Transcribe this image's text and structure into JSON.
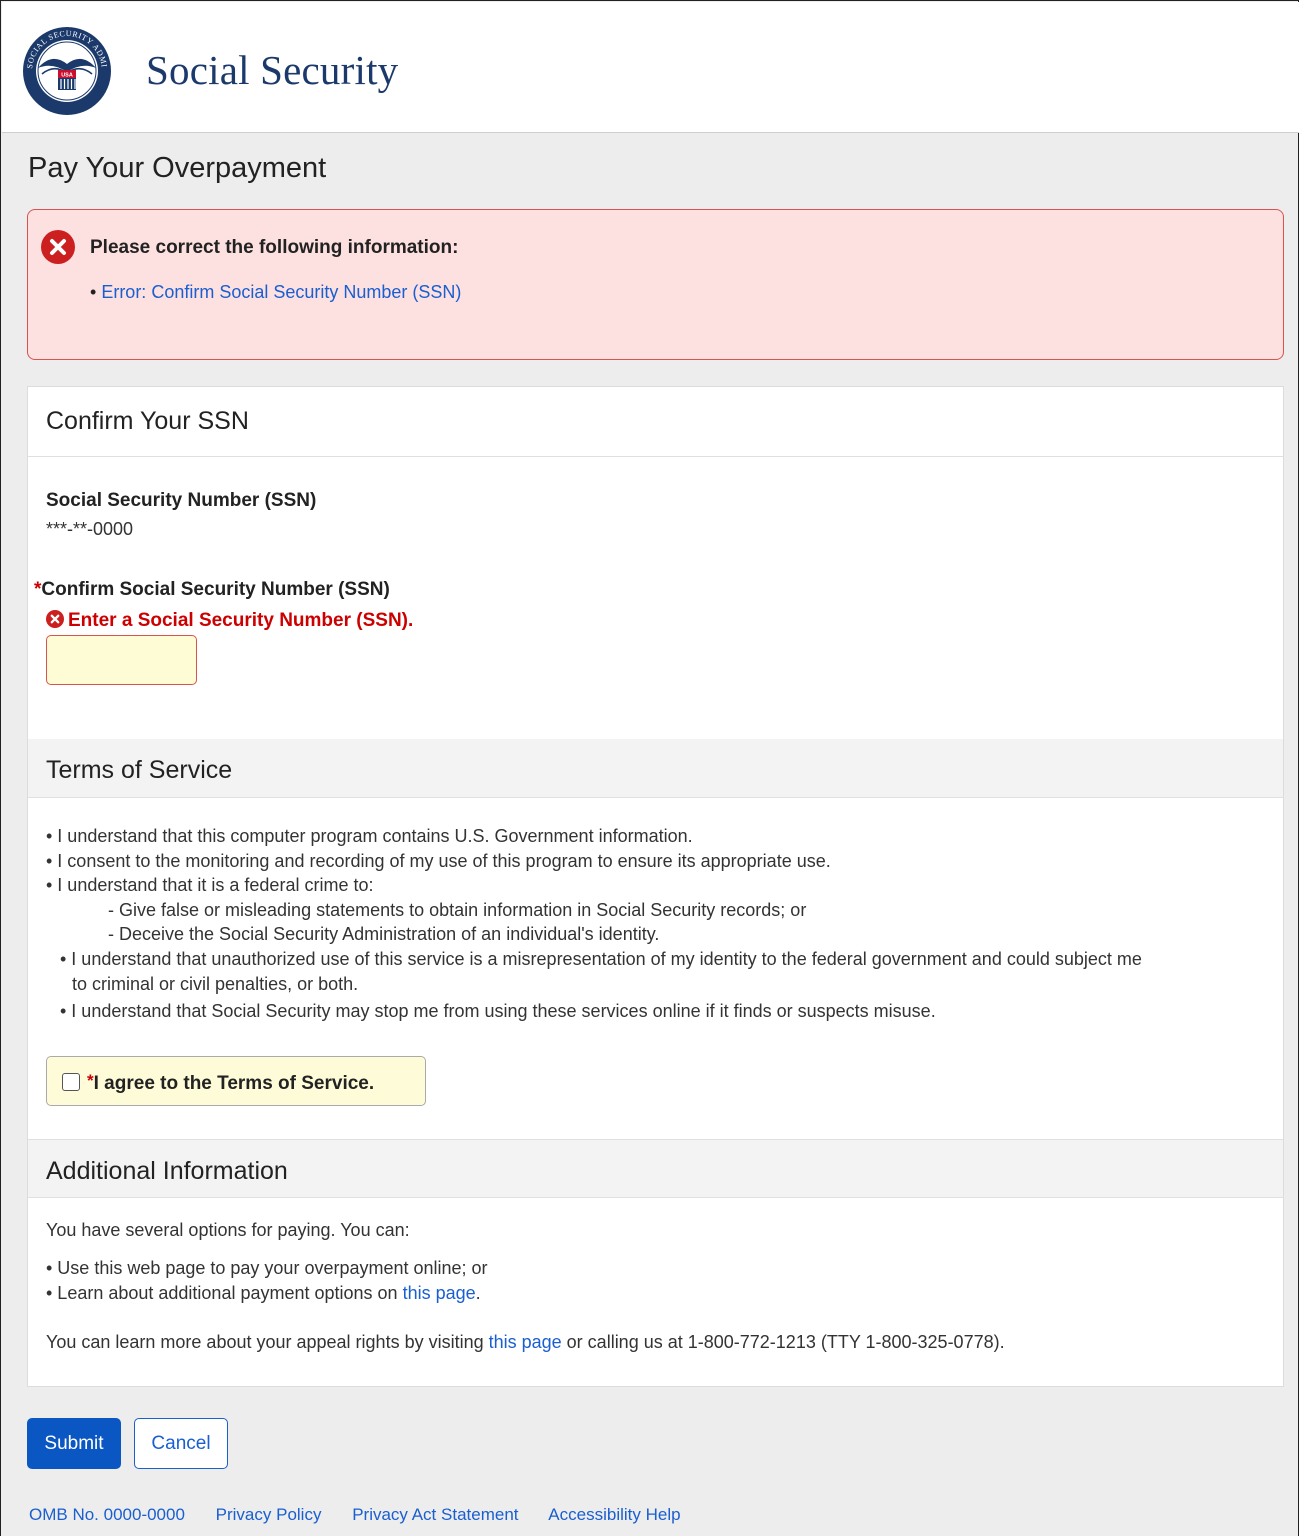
{
  "header": {
    "site_title": "Social Security",
    "seal_text": "SOCIAL SECURITY ADMINISTRATION",
    "seal_usa": "USA"
  },
  "page_title": "Pay Your Overpayment",
  "error_summary": {
    "title": "Please correct the following information:",
    "items": [
      "Error: Confirm Social Security Number (SSN)"
    ]
  },
  "confirm_section": {
    "heading": "Confirm Your SSN",
    "ssn_label": "Social Security Number (SSN)",
    "ssn_value": "***-**-0000",
    "confirm_label": "Confirm Social Security Number (SSN)",
    "required_mark": "*",
    "error": "Enter a Social Security Number (SSN).",
    "input_value": ""
  },
  "terms_section": {
    "heading": "Terms of Service",
    "items": [
      "• I understand that this computer program contains U.S. Government information.",
      "• I consent to the monitoring and recording of my use of this program to ensure its appropriate use.",
      "• I understand that it is a federal crime to:",
      "- Give false or misleading statements to obtain information in Social Security records; or",
      "- Deceive the Social Security Administration of an individual's identity.",
      "• I understand that unauthorized use of this service is a misrepresentation of my identity to the federal government and could subject me",
      "to criminal or civil penalties, or both.",
      "• I understand that Social Security may stop me from using these services online if it finds or suspects misuse."
    ],
    "agree_label": "I agree to the Terms of Service.",
    "agree_required": "*"
  },
  "additional_section": {
    "heading": "Additional Information",
    "intro": "You have several options for paying.  You can:",
    "bullet1": "• Use this web page to pay your overpayment online; or",
    "bullet2_prefix": "• Learn about additional payment options on ",
    "bullet2_link": "this page",
    "bullet2_suffix": ".",
    "appeal_prefix": "You can learn more about your appeal rights by visiting ",
    "appeal_link": "this page",
    "appeal_suffix": " or calling us at 1-800-772-1213 (TTY 1-800-325-0778)."
  },
  "buttons": {
    "submit": "Submit",
    "cancel": "Cancel"
  },
  "footer": {
    "omb": "OMB No. 0000-0000",
    "privacy_policy": "Privacy Policy",
    "privacy_act": "Privacy Act Statement",
    "accessibility": "Accessibility Help"
  },
  "colors": {
    "brand": "#1b3a6b",
    "link": "#1a5fd0",
    "error": "#cc0000",
    "primary_button": "#0a56c2"
  }
}
